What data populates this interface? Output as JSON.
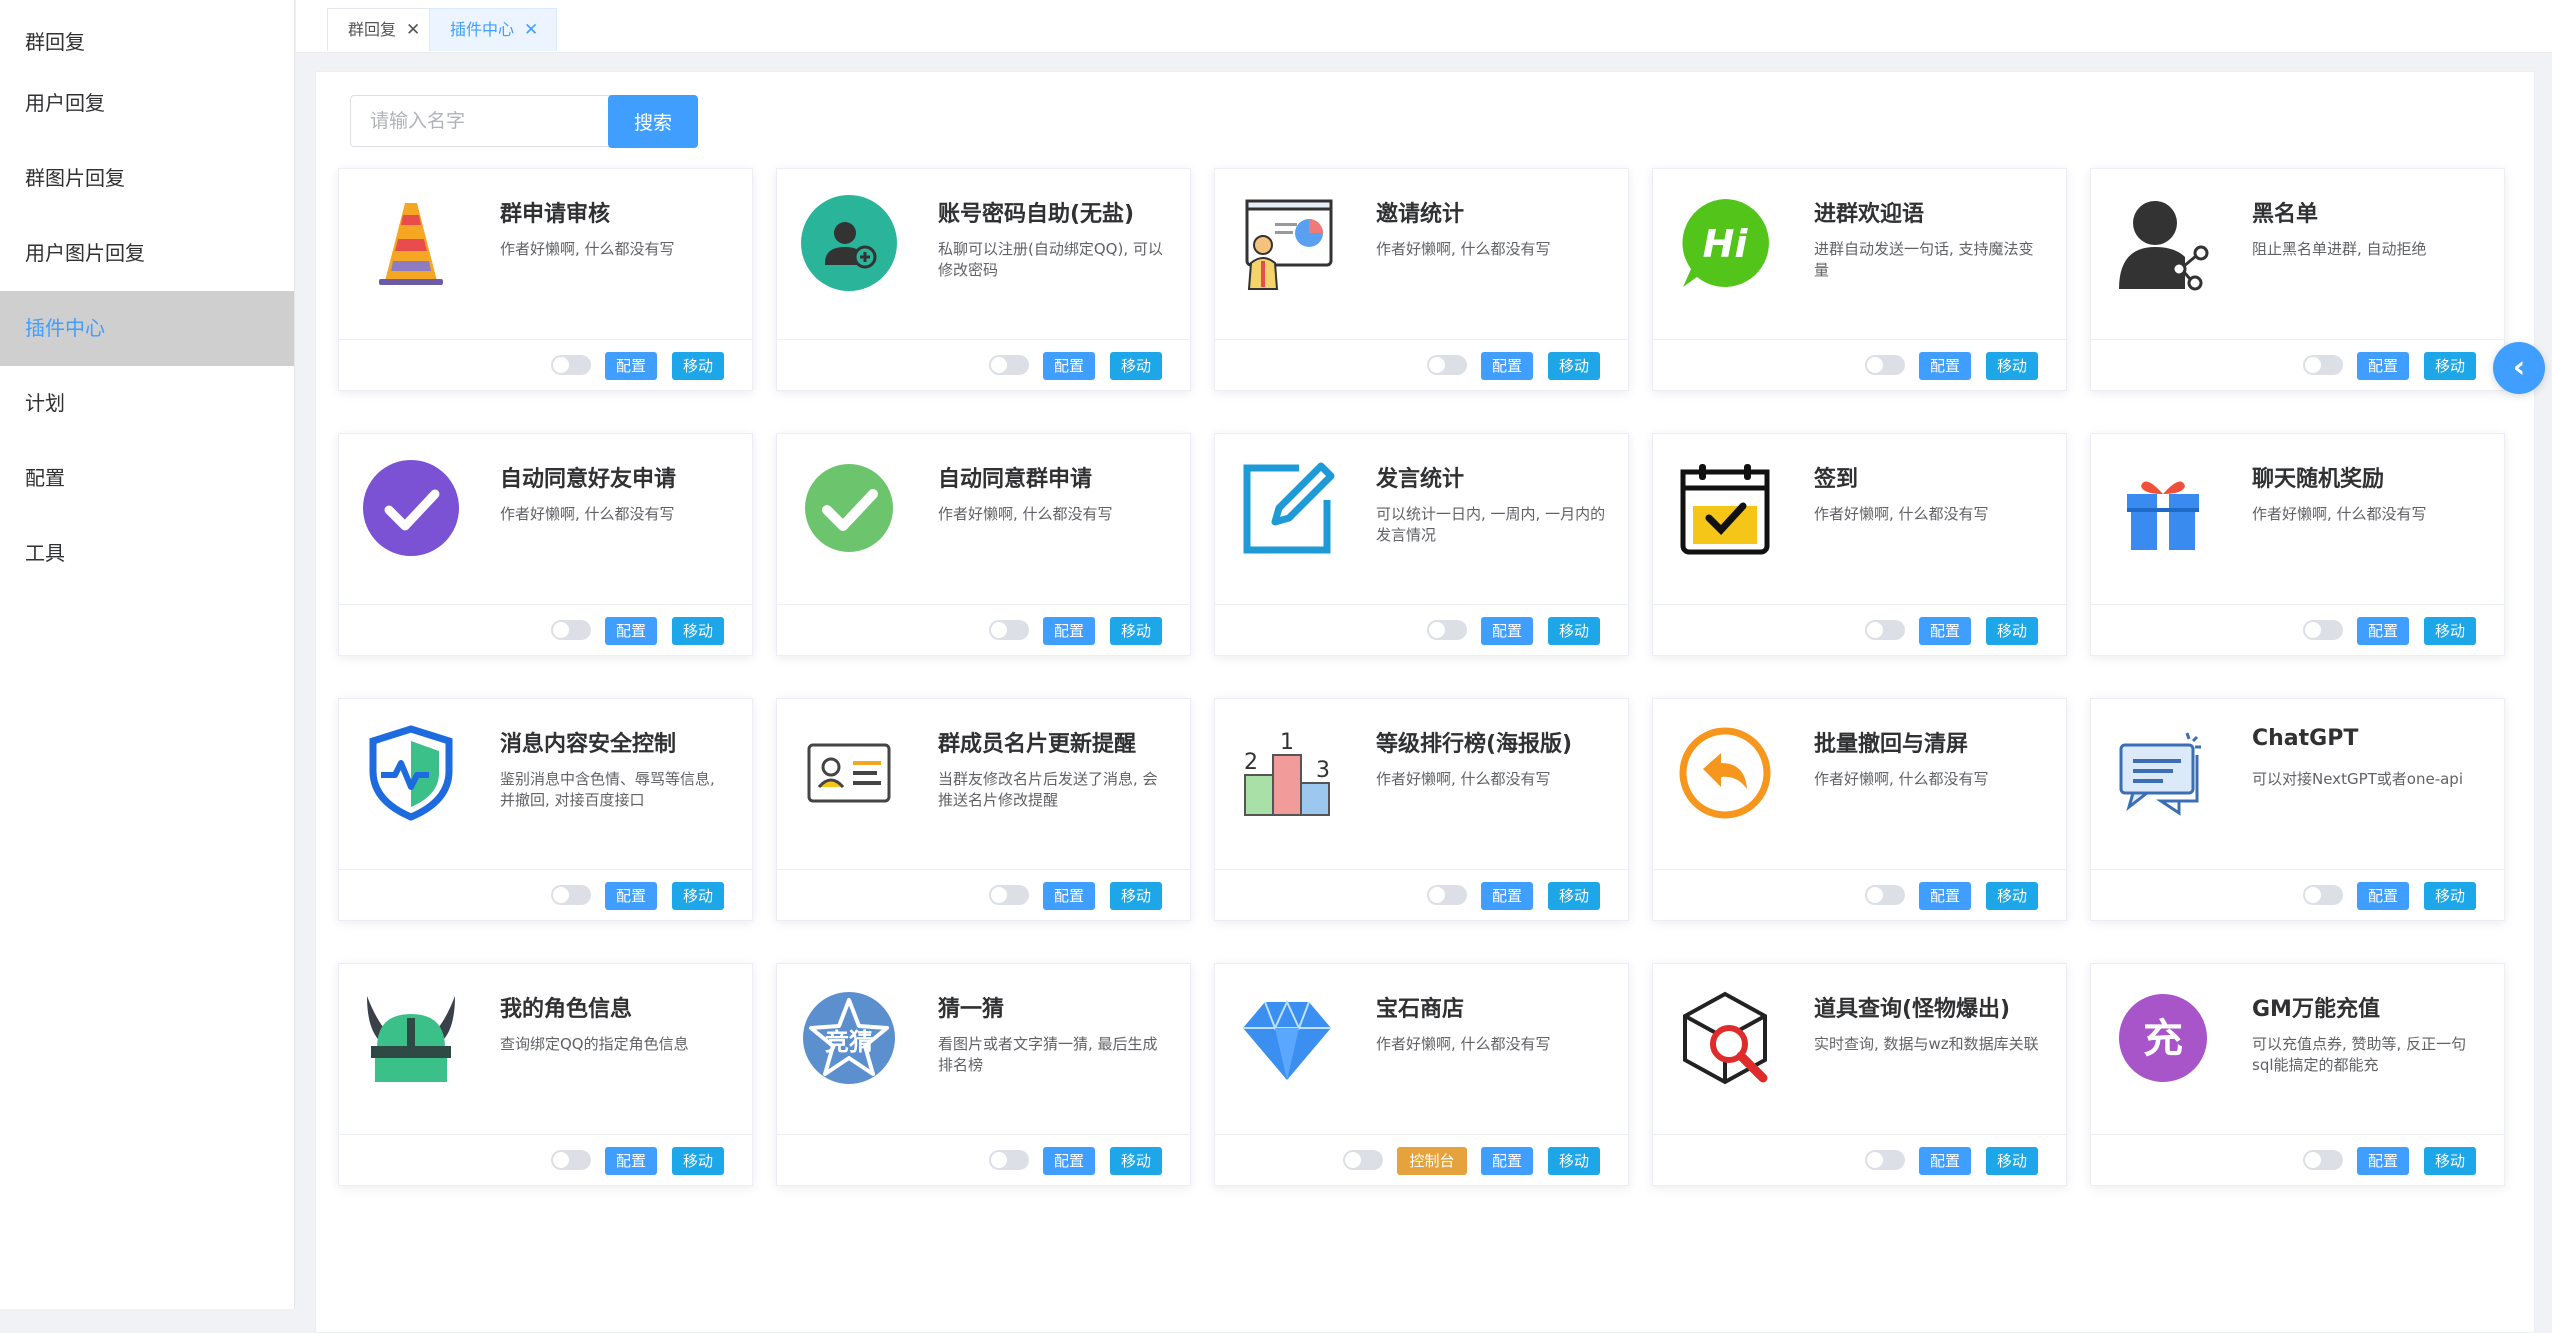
{
  "sidebar": {
    "items": [
      {
        "label": "群回复",
        "active": false
      },
      {
        "label": "用户回复",
        "active": false
      },
      {
        "label": "群图片回复",
        "active": false
      },
      {
        "label": "用户图片回复",
        "active": false
      },
      {
        "label": "插件中心",
        "active": true
      },
      {
        "label": "计划",
        "active": false
      },
      {
        "label": "配置",
        "active": false
      },
      {
        "label": "工具",
        "active": false
      }
    ]
  },
  "tabs": [
    {
      "label": "群回复",
      "active": false
    },
    {
      "label": "插件中心",
      "active": true
    }
  ],
  "search": {
    "placeholder": "请输入名字",
    "button_label": "搜索"
  },
  "plugin_actions": {
    "config_label": "配置",
    "move_label": "移动",
    "console_label": "控制台"
  },
  "plugins": [
    {
      "title": "群申请审核",
      "desc": "作者好懒啊, 什么都没有写",
      "icon": "traffic-cone-icon"
    },
    {
      "title": "账号密码自助(无盐)",
      "desc": "私聊可以注册(自动绑定QQ), 可以修改密码",
      "icon": "add-user-icon"
    },
    {
      "title": "邀请统计",
      "desc": "作者好懒啊, 什么都没有写",
      "icon": "presentation-chart-icon"
    },
    {
      "title": "进群欢迎语",
      "desc": "进群自动发送一句话, 支持魔法变量",
      "icon": "hi-bubble-icon"
    },
    {
      "title": "黑名单",
      "desc": "阻止黑名单进群, 自动拒绝",
      "icon": "user-share-icon"
    },
    {
      "title": "自动同意好友申请",
      "desc": "作者好懒啊, 什么都没有写",
      "icon": "check-circle-purple-icon"
    },
    {
      "title": "自动同意群申请",
      "desc": "作者好懒啊, 什么都没有写",
      "icon": "check-circle-green-icon"
    },
    {
      "title": "发言统计",
      "desc": "可以统计一日内, 一周内, 一月内的发言情况",
      "icon": "edit-icon"
    },
    {
      "title": "签到",
      "desc": "作者好懒啊, 什么都没有写",
      "icon": "calendar-check-icon"
    },
    {
      "title": "聊天随机奖励",
      "desc": "作者好懒啊, 什么都没有写",
      "icon": "gift-icon"
    },
    {
      "title": "消息内容安全控制",
      "desc": "鉴别消息中含色情、辱骂等信息, 并撤回, 对接百度接口",
      "icon": "shield-icon"
    },
    {
      "title": "群成员名片更新提醒",
      "desc": "当群友修改名片后发送了消息, 会推送名片修改提醒",
      "icon": "id-card-icon"
    },
    {
      "title": "等级排行榜(海报版)",
      "desc": "作者好懒啊, 什么都没有写",
      "icon": "podium-icon"
    },
    {
      "title": "批量撤回与清屏",
      "desc": "作者好懒啊, 什么都没有写",
      "icon": "undo-circle-icon"
    },
    {
      "title": "ChatGPT",
      "desc": "可以对接NextGPT或者one-api",
      "icon": "chat-icon"
    },
    {
      "title": "我的角色信息",
      "desc": "查询绑定QQ的指定角色信息",
      "icon": "viking-helmet-icon"
    },
    {
      "title": "猜一猜",
      "desc": "看图片或者文字猜一猜, 最后生成排名榜",
      "icon": "guess-badge-icon",
      "icon_text": "竞猜"
    },
    {
      "title": "宝石商店",
      "desc": "作者好懒啊, 什么都没有写",
      "icon": "diamond-icon",
      "has_console": true
    },
    {
      "title": "道具查询(怪物爆出)",
      "desc": "实时查询, 数据与wz和数据库关联",
      "icon": "cube-search-icon"
    },
    {
      "title": "GM万能充值",
      "desc": "可以充值点券, 赞助等, 反正一句sql能搞定的都能充",
      "icon": "recharge-icon",
      "icon_text": "充"
    }
  ],
  "colors": {
    "primary": "#409eff",
    "move": "#1ea7e8",
    "console": "#e6a23c",
    "active_menu_bg": "#cfcfcf"
  }
}
